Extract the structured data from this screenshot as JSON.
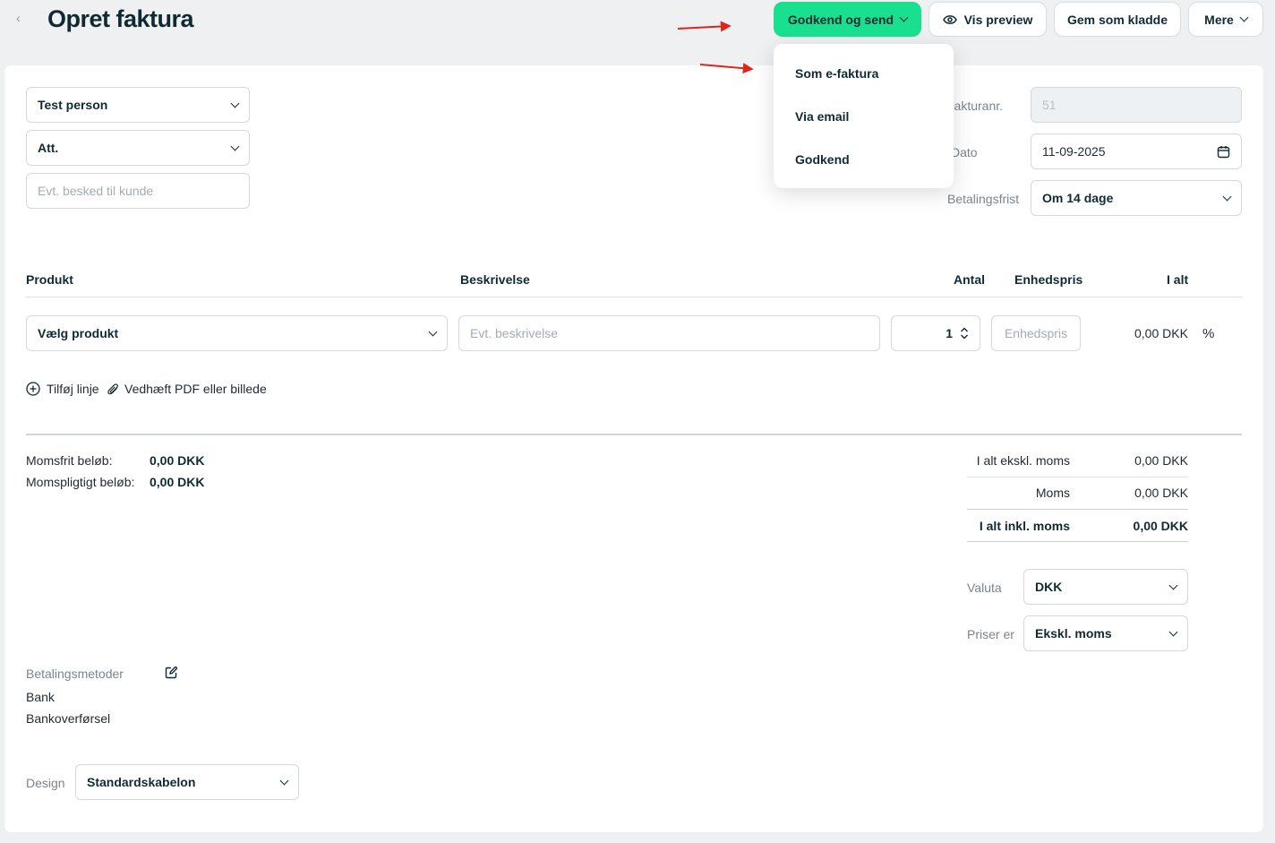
{
  "header": {
    "back_glyph": "‹",
    "title": "Opret faktura",
    "approve_send_label": "Godkend og send",
    "preview_label": "Vis preview",
    "save_draft_label": "Gem som kladde",
    "more_label": "Mere"
  },
  "dropdown": {
    "items": [
      "Som e-faktura",
      "Via email",
      "Godkend"
    ]
  },
  "customer": {
    "contact": "Test person",
    "att": "Att.",
    "message_placeholder": "Evt. besked til kunde"
  },
  "invoice_meta": {
    "number_label": "Fakturanr.",
    "number_value": "51",
    "date_label": "Dato",
    "date_value": "11-09-2025",
    "due_label": "Betalingsfrist",
    "due_value": "Om 14 dage"
  },
  "lines": {
    "headers": {
      "product": "Produkt",
      "description": "Beskrivelse",
      "qty": "Antal",
      "unit_price": "Enhedspris",
      "total": "I alt"
    },
    "row": {
      "product": "Vælg produkt",
      "description_placeholder": "Evt. beskrivelse",
      "qty": "1",
      "unit_price_placeholder": "Enhedspris",
      "total": "0,00 DKK",
      "discount_symbol": "%"
    },
    "add_line": "Tilføj linje",
    "attach": "Vedhæft PDF eller billede"
  },
  "totals_left": {
    "vat_free_label": "Momsfrit beløb:",
    "vat_free_value": "0,00 DKK",
    "vat_liable_label": "Momspligtigt beløb:",
    "vat_liable_value": "0,00 DKK"
  },
  "totals_right": {
    "excl_label": "I alt ekskl. moms",
    "excl_value": "0,00 DKK",
    "vat_label": "Moms",
    "vat_value": "0,00 DKK",
    "incl_label": "I alt inkl. moms",
    "incl_value": "0,00 DKK"
  },
  "settings": {
    "currency_label": "Valuta",
    "currency_value": "DKK",
    "prices_label": "Priser er",
    "prices_value": "Ekskl. moms"
  },
  "payment": {
    "label": "Betalingsmetoder",
    "method_1": "Bank",
    "method_2": "Bankoverførsel"
  },
  "design": {
    "label": "Design",
    "value": "Standardskabelon"
  },
  "colors": {
    "primary": "#19e08f",
    "annotation_arrow": "#e0241b"
  }
}
